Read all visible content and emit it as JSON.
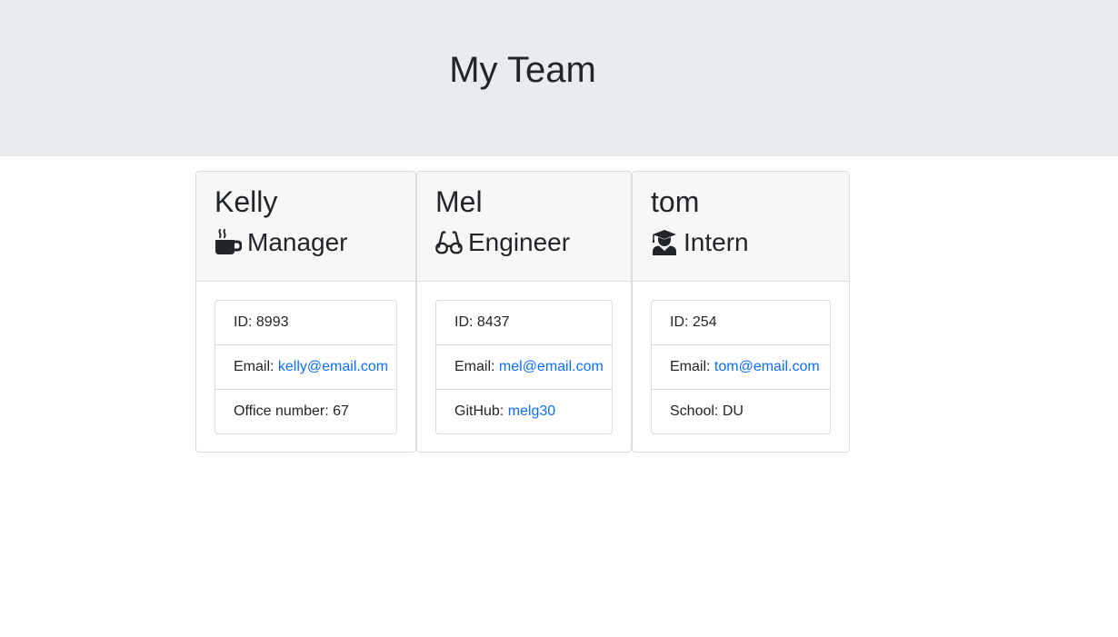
{
  "header": {
    "title": "My Team"
  },
  "cards": [
    {
      "name": "Kelly",
      "role": "Manager",
      "icon": "coffee-icon",
      "id_label": "ID: ",
      "id": "8993",
      "email_label": "Email: ",
      "email": "kelly@email.com",
      "extra_label": "Office number: ",
      "extra": "67"
    },
    {
      "name": "Mel",
      "role": "Engineer",
      "icon": "glasses-icon",
      "id_label": "ID: ",
      "id": "8437",
      "email_label": "Email: ",
      "email": "mel@email.com",
      "extra_label": "GitHub: ",
      "extra": "melg30"
    },
    {
      "name": "tom",
      "role": "Intern",
      "icon": "user-graduate-icon",
      "id_label": "ID: ",
      "id": "254",
      "email_label": "Email: ",
      "email": "tom@email.com",
      "extra_label": "School: ",
      "extra": "DU"
    }
  ],
  "colors": {
    "jumbotron": "#e9ecef",
    "link": "#0d6efd",
    "card_header": "#f7f7f7"
  }
}
